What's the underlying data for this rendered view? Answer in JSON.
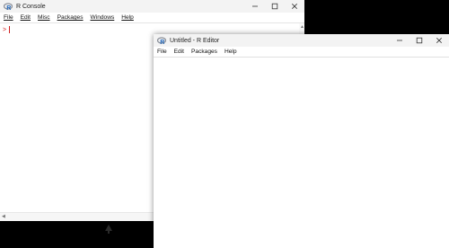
{
  "console": {
    "title": "R Console",
    "menu": [
      "File",
      "Edit",
      "Misc",
      "Packages",
      "Windows",
      "Help"
    ],
    "prompt": ">"
  },
  "editor": {
    "title": "Untitled - R Editor",
    "menu": [
      "File",
      "Edit",
      "Packages",
      "Help"
    ]
  },
  "colors": {
    "prompt": "#d02020",
    "titlebar": "#f3f3f3",
    "desktop": "#000000"
  },
  "icons": [
    "r-logo-icon",
    "minimize-icon",
    "maximize-icon",
    "close-icon",
    "scroll-up-icon",
    "scroll-down-icon",
    "scroll-left-icon"
  ]
}
